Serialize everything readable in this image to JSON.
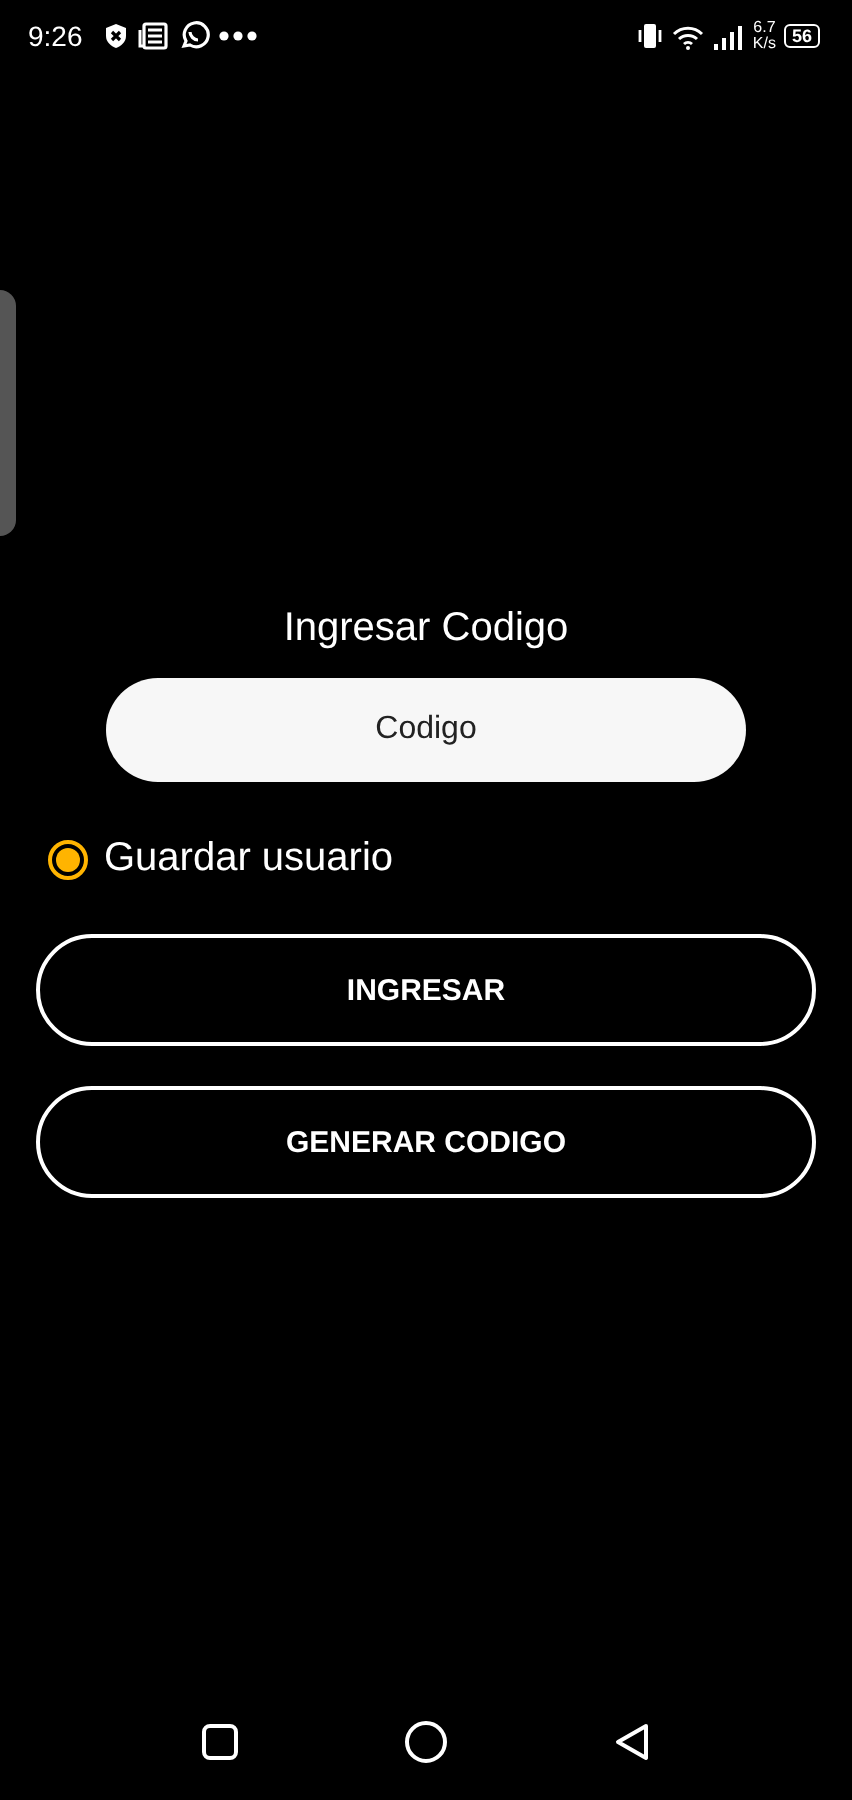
{
  "status_bar": {
    "time": "9:26",
    "speed": "6.7",
    "speed_unit": "K/s",
    "battery": "56"
  },
  "title": "Ingresar Codigo",
  "code_field": {
    "placeholder": "Codigo"
  },
  "remember": {
    "label": "Guardar usuario",
    "selected": true
  },
  "buttons": [
    "INGRESAR",
    "GENERAR CODIGO"
  ]
}
